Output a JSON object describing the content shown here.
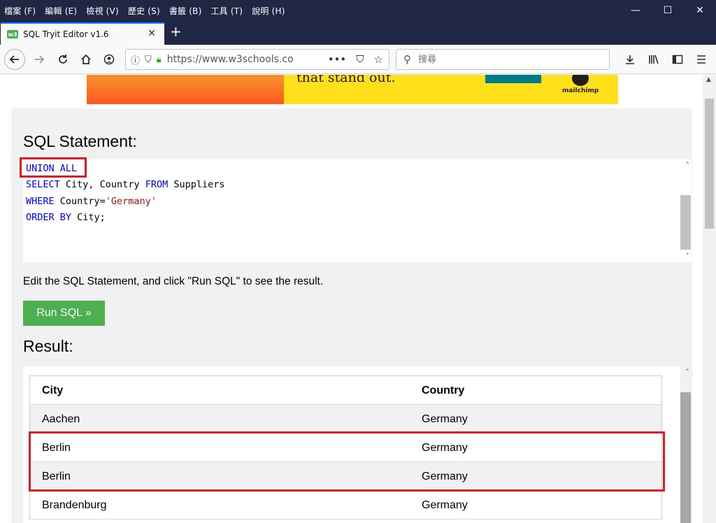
{
  "menubar": {
    "items": [
      "檔案 (F)",
      "編輯 (E)",
      "檢視 (V)",
      "歷史 (S)",
      "書籤 (B)",
      "工具 (T)",
      "說明 (H)"
    ]
  },
  "window_controls": {
    "minimize": "—",
    "maximize": "☐",
    "close": "✕"
  },
  "tab": {
    "favicon": "w3",
    "title": "SQL Tryit Editor v1.6",
    "close": "✕",
    "new_tab": "+"
  },
  "nav": {
    "url": "https://www.w3schools.co",
    "search_placeholder": "搜尋"
  },
  "ad": {
    "text": "that stand out.",
    "brand": "mailchimp"
  },
  "sql": {
    "heading": "SQL Statement:",
    "lines": [
      {
        "kw1": "UNION ALL",
        "rest": ""
      },
      {
        "kw1": "SELECT",
        "rest": " City, Country ",
        "kw2": "FROM",
        "rest2": " Suppliers"
      },
      {
        "kw1": "WHERE",
        "rest": " Country=",
        "str": "'Germany'"
      },
      {
        "kw1": "ORDER BY",
        "rest": " City;"
      }
    ]
  },
  "instruction": "Edit the SQL Statement, and click \"Run SQL\" to see the result.",
  "run_button": "Run SQL »",
  "result": {
    "heading": "Result:",
    "columns": [
      "City",
      "Country"
    ],
    "rows": [
      [
        "Aachen",
        "Germany"
      ],
      [
        "Berlin",
        "Germany"
      ],
      [
        "Berlin",
        "Germany"
      ],
      [
        "Brandenburg",
        "Germany"
      ]
    ]
  },
  "colors": {
    "highlight": "#e01b24",
    "run_button": "#4caf50",
    "keyword": "#0000ff",
    "string": "#a31515",
    "titlebar": "#1f2745"
  }
}
